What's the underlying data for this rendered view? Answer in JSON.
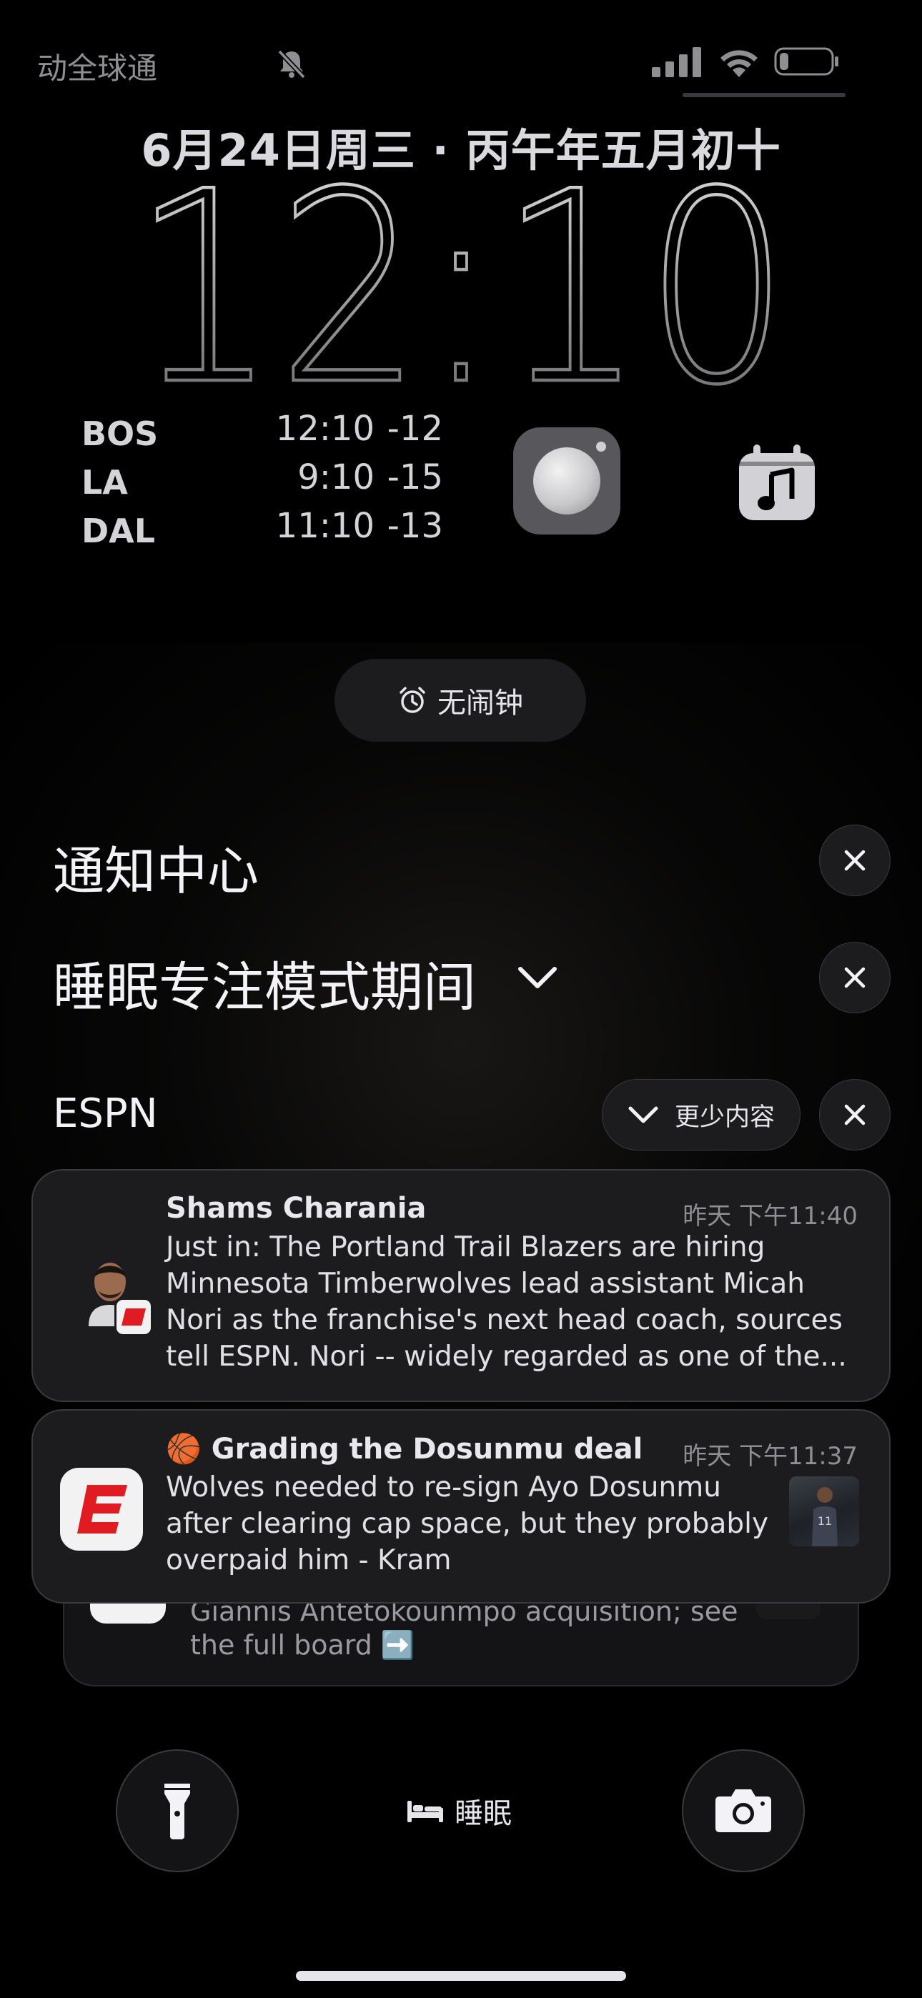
{
  "status_bar": {
    "carrier": "动全球通",
    "icons": [
      "bell-slash-icon",
      "cellular-signal-icon",
      "wifi-icon",
      "battery-icon"
    ],
    "battery_level": 0.15
  },
  "lock_screen": {
    "date": "6月24日周三 · 丙午年五月初十",
    "time": "12:10"
  },
  "widgets": {
    "world_clock": [
      {
        "city": "BOS",
        "time": "12:10",
        "offset": "-12"
      },
      {
        "city": "LA",
        "time": "9:10",
        "offset": "-15"
      },
      {
        "city": "DAL",
        "time": "11:10",
        "offset": "-13"
      }
    ],
    "icons": [
      "moon-widget-icon",
      "music-calendar-icon"
    ]
  },
  "alarm": {
    "label": "无闹钟",
    "icon": "alarm-clock-icon"
  },
  "notification_center": {
    "title": "通知中心",
    "focus_section": "睡眠专注模式期间",
    "app_group": "ESPN",
    "show_less_label": "更少内容",
    "notifications": [
      {
        "title": "Shams Charania",
        "time": "昨天 下午11:40",
        "body_lines": [
          "Just in: The Portland Trail Blazers are hiring",
          "Minnesota Timberwolves lead assistant Micah",
          "Nori as the franchise's next head coach, sources",
          "tell ESPN. Nori -- widely regarded as one of the..."
        ]
      },
      {
        "title": "🏀 Grading the Dosunmu deal",
        "time": "昨天 下午11:37",
        "body_lines": [
          "Wolves needed to re-sign Ayo Dosunmu",
          "after clearing cap space, but they probably",
          "overpaid him - Kram"
        ]
      },
      {
        "body_lines": [
          "Giannis Antetokounmpo acquisition; see",
          "the full board ➡️"
        ]
      }
    ]
  },
  "bottom_bar": {
    "sleep_label": "睡眠",
    "icons": [
      "flashlight-icon",
      "bed-icon",
      "camera-icon"
    ]
  },
  "colors": {
    "background": "#000000",
    "card": "#1c1c1e",
    "espn_red": "#e11b22",
    "secondary_text": "#8e8e93"
  }
}
